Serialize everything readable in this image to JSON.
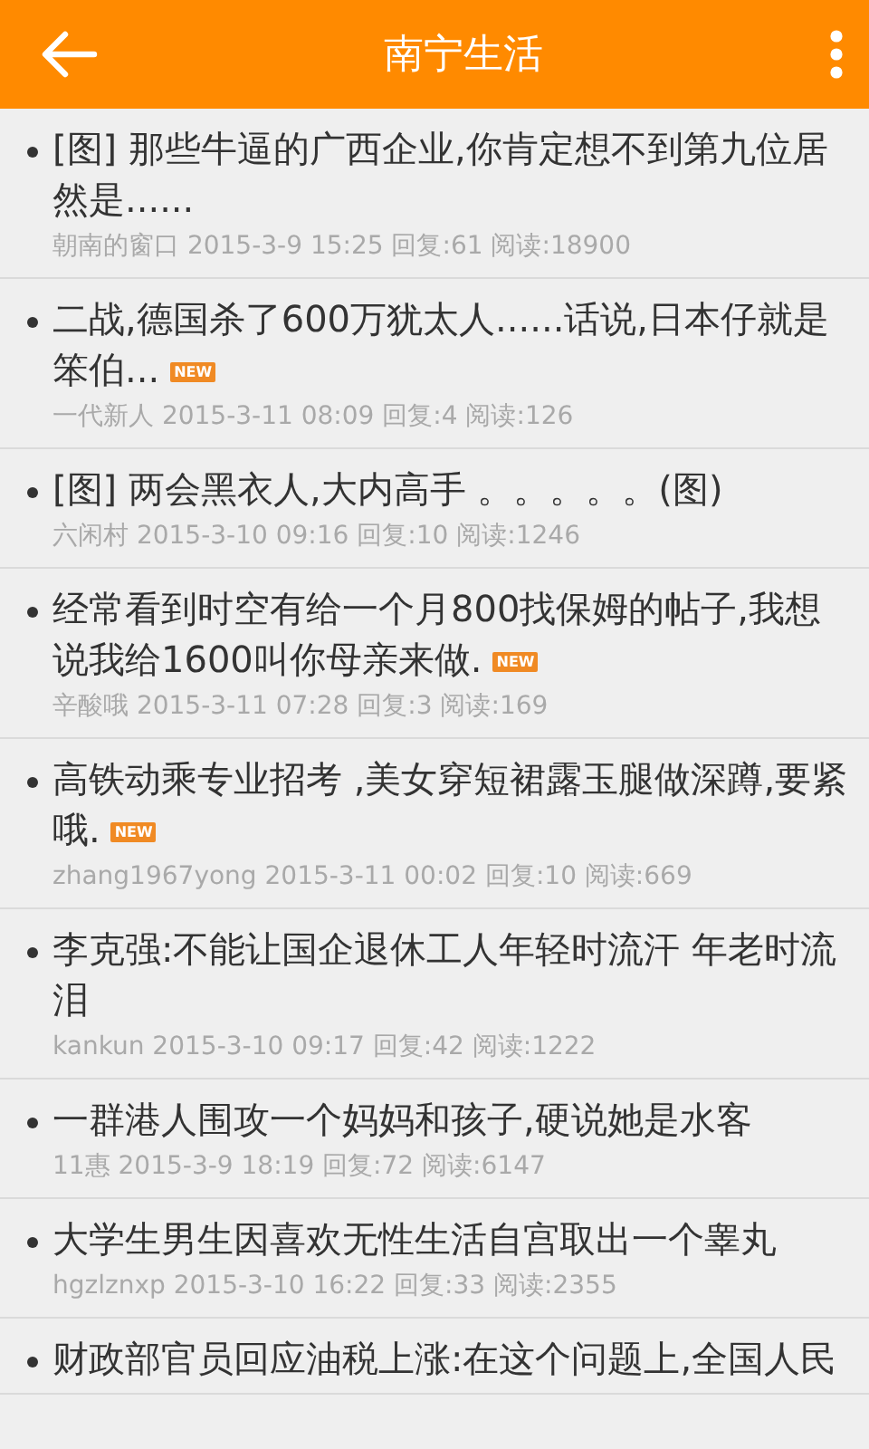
{
  "header": {
    "title": "南宁生活"
  },
  "posts": [
    {
      "title": "[图] 那些牛逼的广西企业,你肯定想不到第九位居然是......",
      "author": "朝南的窗口",
      "time": "2015-3-9 15:25",
      "replies": "回复:61",
      "reads": "阅读:18900"
    },
    {
      "title": "二战,德国杀了600万犹太人......话说,日本仔就是笨伯...",
      "badge": "NEW",
      "author": "一代新人",
      "time": "2015-3-11 08:09",
      "replies": "回复:4",
      "reads": "阅读:126"
    },
    {
      "title": "[图] 两会黑衣人,大内高手 。。。。。(图)",
      "author": "六闲村",
      "time": "2015-3-10 09:16",
      "replies": "回复:10",
      "reads": "阅读:1246"
    },
    {
      "title": "经常看到时空有给一个月800找保姆的帖子,我想说我给1600叫你母亲来做.",
      "badge": "NEW",
      "author": "辛酸哦",
      "time": "2015-3-11 07:28",
      "replies": "回复:3",
      "reads": "阅读:169"
    },
    {
      "title": "高铁动乘专业招考 ,美女穿短裙露玉腿做深蹲,要紧哦.",
      "badge": "NEW",
      "author": "zhang1967yong",
      "time": "2015-3-11 00:02",
      "replies": "回复:10",
      "reads": "阅读:669"
    },
    {
      "title": "李克强:不能让国企退休工人年轻时流汗 年老时流泪",
      "author": "kankun",
      "time": "2015-3-10 09:17",
      "replies": "回复:42",
      "reads": "阅读:1222"
    },
    {
      "title": "一群港人围攻一个妈妈和孩子,硬说她是水客",
      "author": "11惠",
      "time": "2015-3-9 18:19",
      "replies": "回复:72",
      "reads": "阅读:6147"
    },
    {
      "title": "大学生男生因喜欢无性生活自宫取出一个睾丸",
      "author": "hgzlznxp",
      "time": "2015-3-10 16:22",
      "replies": "回复:33",
      "reads": "阅读:2355"
    },
    {
      "title": "财政部官员回应油税上涨:在这个问题上,全国人民"
    }
  ]
}
